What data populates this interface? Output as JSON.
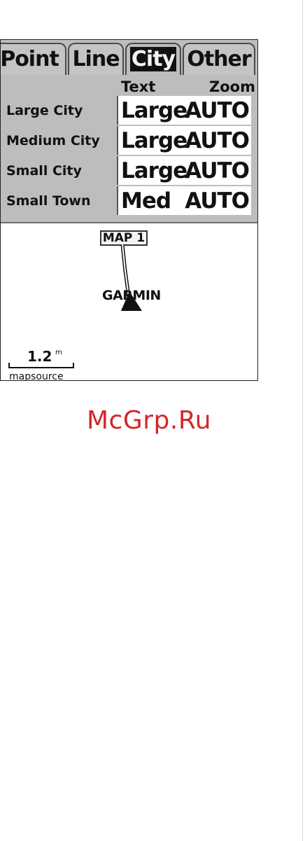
{
  "tabs": [
    {
      "label": "Point",
      "active": false
    },
    {
      "label": "Line",
      "active": false
    },
    {
      "label": "City",
      "active": true
    },
    {
      "label": "Other",
      "active": false
    }
  ],
  "columns": {
    "text": "Text",
    "zoom": "Zoom"
  },
  "rows": [
    {
      "label": "Large City",
      "text": "Large",
      "zoom": "AUTO"
    },
    {
      "label": "Medium City",
      "text": "Large",
      "zoom": "AUTO"
    },
    {
      "label": "Small City",
      "text": "Large",
      "zoom": "AUTO"
    },
    {
      "label": "Small Town",
      "text": "Med",
      "zoom": "AUTO"
    }
  ],
  "map": {
    "waypoint_label": "MAP 1",
    "place_label": "GARMIN",
    "scale_value": "1.2",
    "scale_unit": "m",
    "source": "mapsource"
  },
  "watermark": "McGrp.Ru",
  "colors": {
    "panel": "#bdbdbd",
    "watermark": "#d4262b"
  }
}
